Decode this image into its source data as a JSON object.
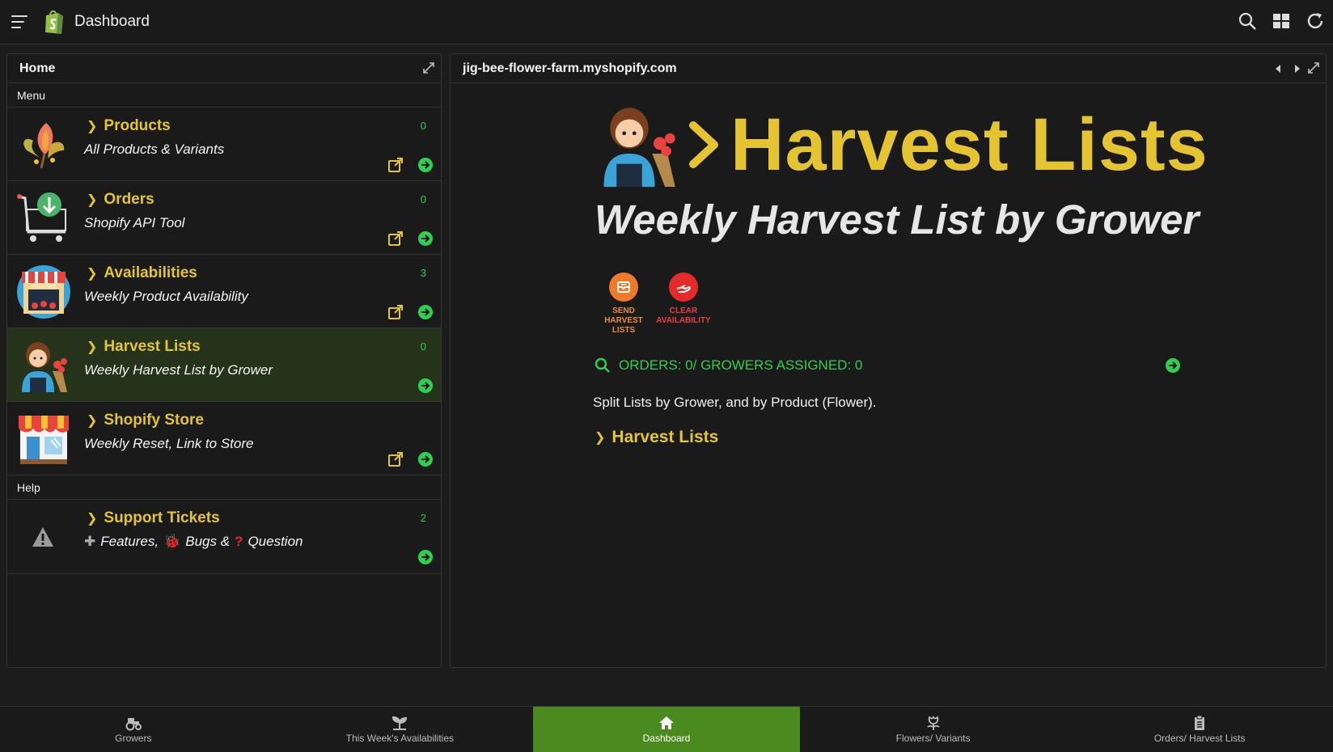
{
  "topbar": {
    "title": "Dashboard",
    "icons": [
      "menu-icon",
      "shopify-logo",
      "search-icon",
      "grid-icon",
      "refresh-icon"
    ]
  },
  "left_panel": {
    "title": "Home",
    "menu_label": "Menu",
    "help_label": "Help",
    "items": [
      {
        "title": "Products",
        "subtitle": "All Products & Variants",
        "count": "0",
        "icon": "flower-bouquet-icon"
      },
      {
        "title": "Orders",
        "subtitle": "Shopify API Tool",
        "count": "0",
        "icon": "cart-download-icon"
      },
      {
        "title": "Availabilities",
        "subtitle": "Weekly Product Availability",
        "count": "3",
        "icon": "flower-shop-icon"
      },
      {
        "title": "Harvest Lists",
        "subtitle": "Weekly Harvest List by Grower",
        "count": "0",
        "icon": "grower-icon"
      },
      {
        "title": "Shopify Store",
        "subtitle": "Weekly Reset, Link to Store",
        "count": "",
        "icon": "storefront-icon"
      }
    ],
    "help_items": [
      {
        "title": "Support Tickets",
        "subtitle_parts": [
          "Features,",
          "Bugs &",
          "Question"
        ],
        "count": "2",
        "icon": "warning-icon"
      }
    ]
  },
  "right_panel": {
    "title": "jig-bee-flower-farm.myshopify.com",
    "hero_title": "Harvest Lists",
    "hero_subtitle": "Weekly Harvest List by Grower",
    "actions": [
      {
        "label_lines": [
          "SEND",
          "HARVEST",
          "LISTS"
        ],
        "color": "#ee7a2a",
        "icon": "email-icon"
      },
      {
        "label_lines": [
          "CLEAR",
          "AVAILABILITY"
        ],
        "color": "#e52a2a",
        "icon": "hand-icon"
      }
    ],
    "orders_line": "ORDERS: 0/ GROWERS ASSIGNED: 0",
    "description": "Split Lists by Grower, and by Product (Flower).",
    "link_title": "Harvest Lists"
  },
  "bottom_tabs": [
    {
      "label": "Growers",
      "icon": "tractor-icon",
      "active": false
    },
    {
      "label": "This Week's Availabilities",
      "icon": "seedling-icon",
      "active": false
    },
    {
      "label": "Dashboard",
      "icon": "home-icon",
      "active": true
    },
    {
      "label": "Flowers/ Variants",
      "icon": "flower-icon",
      "active": false
    },
    {
      "label": "Orders/ Harvest Lists",
      "icon": "clipboard-icon",
      "active": false
    }
  ],
  "colors": {
    "accent": "#e4c531",
    "green": "#2fd04f",
    "active_tab": "#4a8a1f"
  }
}
